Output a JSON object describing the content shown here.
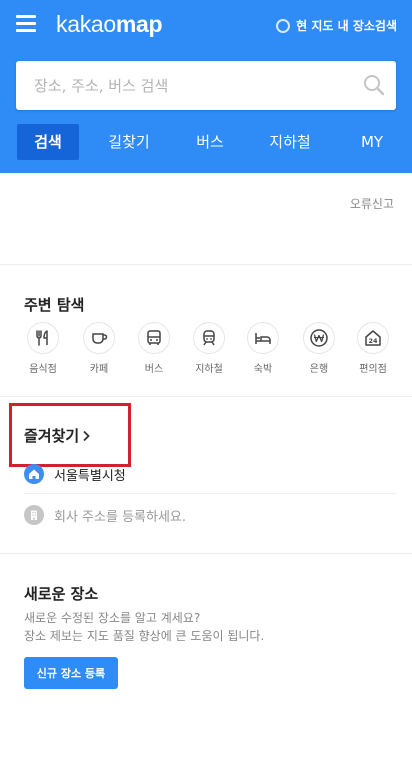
{
  "header": {
    "logo_part1": "kakao",
    "logo_part2": "map",
    "map_search_label": "현 지도 내 장소검색"
  },
  "search": {
    "placeholder": "장소, 주소, 버스 검색"
  },
  "tabs": [
    {
      "label": "검색",
      "active": true
    },
    {
      "label": "길찾기",
      "active": false
    },
    {
      "label": "버스",
      "active": false
    },
    {
      "label": "지하철",
      "active": false
    },
    {
      "label": "MY",
      "active": false
    }
  ],
  "report_label": "오류신고",
  "nearby": {
    "title": "주변 탐색",
    "categories": [
      {
        "label": "음식점",
        "icon": "restaurant-icon"
      },
      {
        "label": "카페",
        "icon": "cafe-icon"
      },
      {
        "label": "버스",
        "icon": "bus-icon"
      },
      {
        "label": "지하철",
        "icon": "subway-icon"
      },
      {
        "label": "숙박",
        "icon": "lodging-icon"
      },
      {
        "label": "은행",
        "icon": "bank-icon"
      },
      {
        "label": "편의점",
        "icon": "convenience-store-icon"
      }
    ]
  },
  "favorites": {
    "title": "즐겨찾기",
    "home_label": "서울특별시청",
    "work_label": "회사 주소를 등록하세요."
  },
  "new_places": {
    "title": "새로운 장소",
    "desc1": "새로운 수정된 장소를 알고 계세요?",
    "desc2": "장소 제보는 지도 품질 향상에 큰 도움이 됩니다.",
    "button_label": "신규 장소 등록"
  },
  "colors": {
    "brand_blue": "#2f8bf6",
    "active_tab": "#1565d8",
    "highlight_red": "#d4202a"
  }
}
